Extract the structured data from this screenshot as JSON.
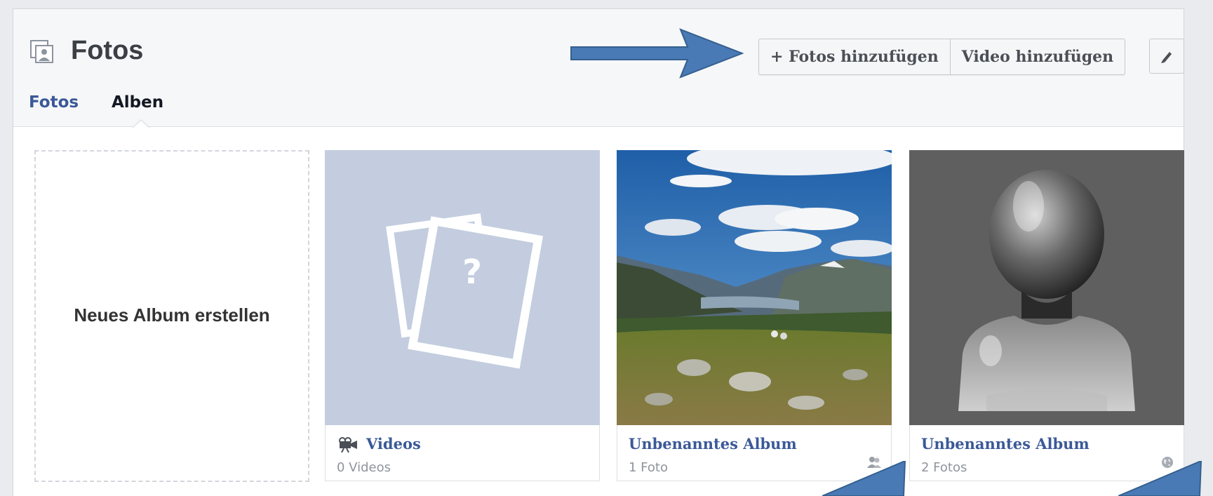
{
  "header": {
    "title": "Fotos",
    "tabs": [
      {
        "label": "Fotos",
        "active": false
      },
      {
        "label": "Alben",
        "active": true
      }
    ],
    "add_photos_label": "+ Fotos hinzufügen",
    "add_video_label": "Video hinzufügen"
  },
  "albums": {
    "create_label": "Neues Album erstellen",
    "items": [
      {
        "title": "Videos",
        "subtitle": "0 Videos",
        "icon": "video-camera-icon"
      },
      {
        "title": "Unbenanntes Album",
        "subtitle": "1 Foto",
        "privacy_icon": "friends-icon"
      },
      {
        "title": "Unbenanntes Album",
        "subtitle": "2 Fotos",
        "privacy_icon": "globe-icon"
      }
    ]
  },
  "colors": {
    "link_blue": "#3b5998",
    "arrow_blue": "#4a7ab5",
    "placeholder_bg": "#c3cddf"
  }
}
